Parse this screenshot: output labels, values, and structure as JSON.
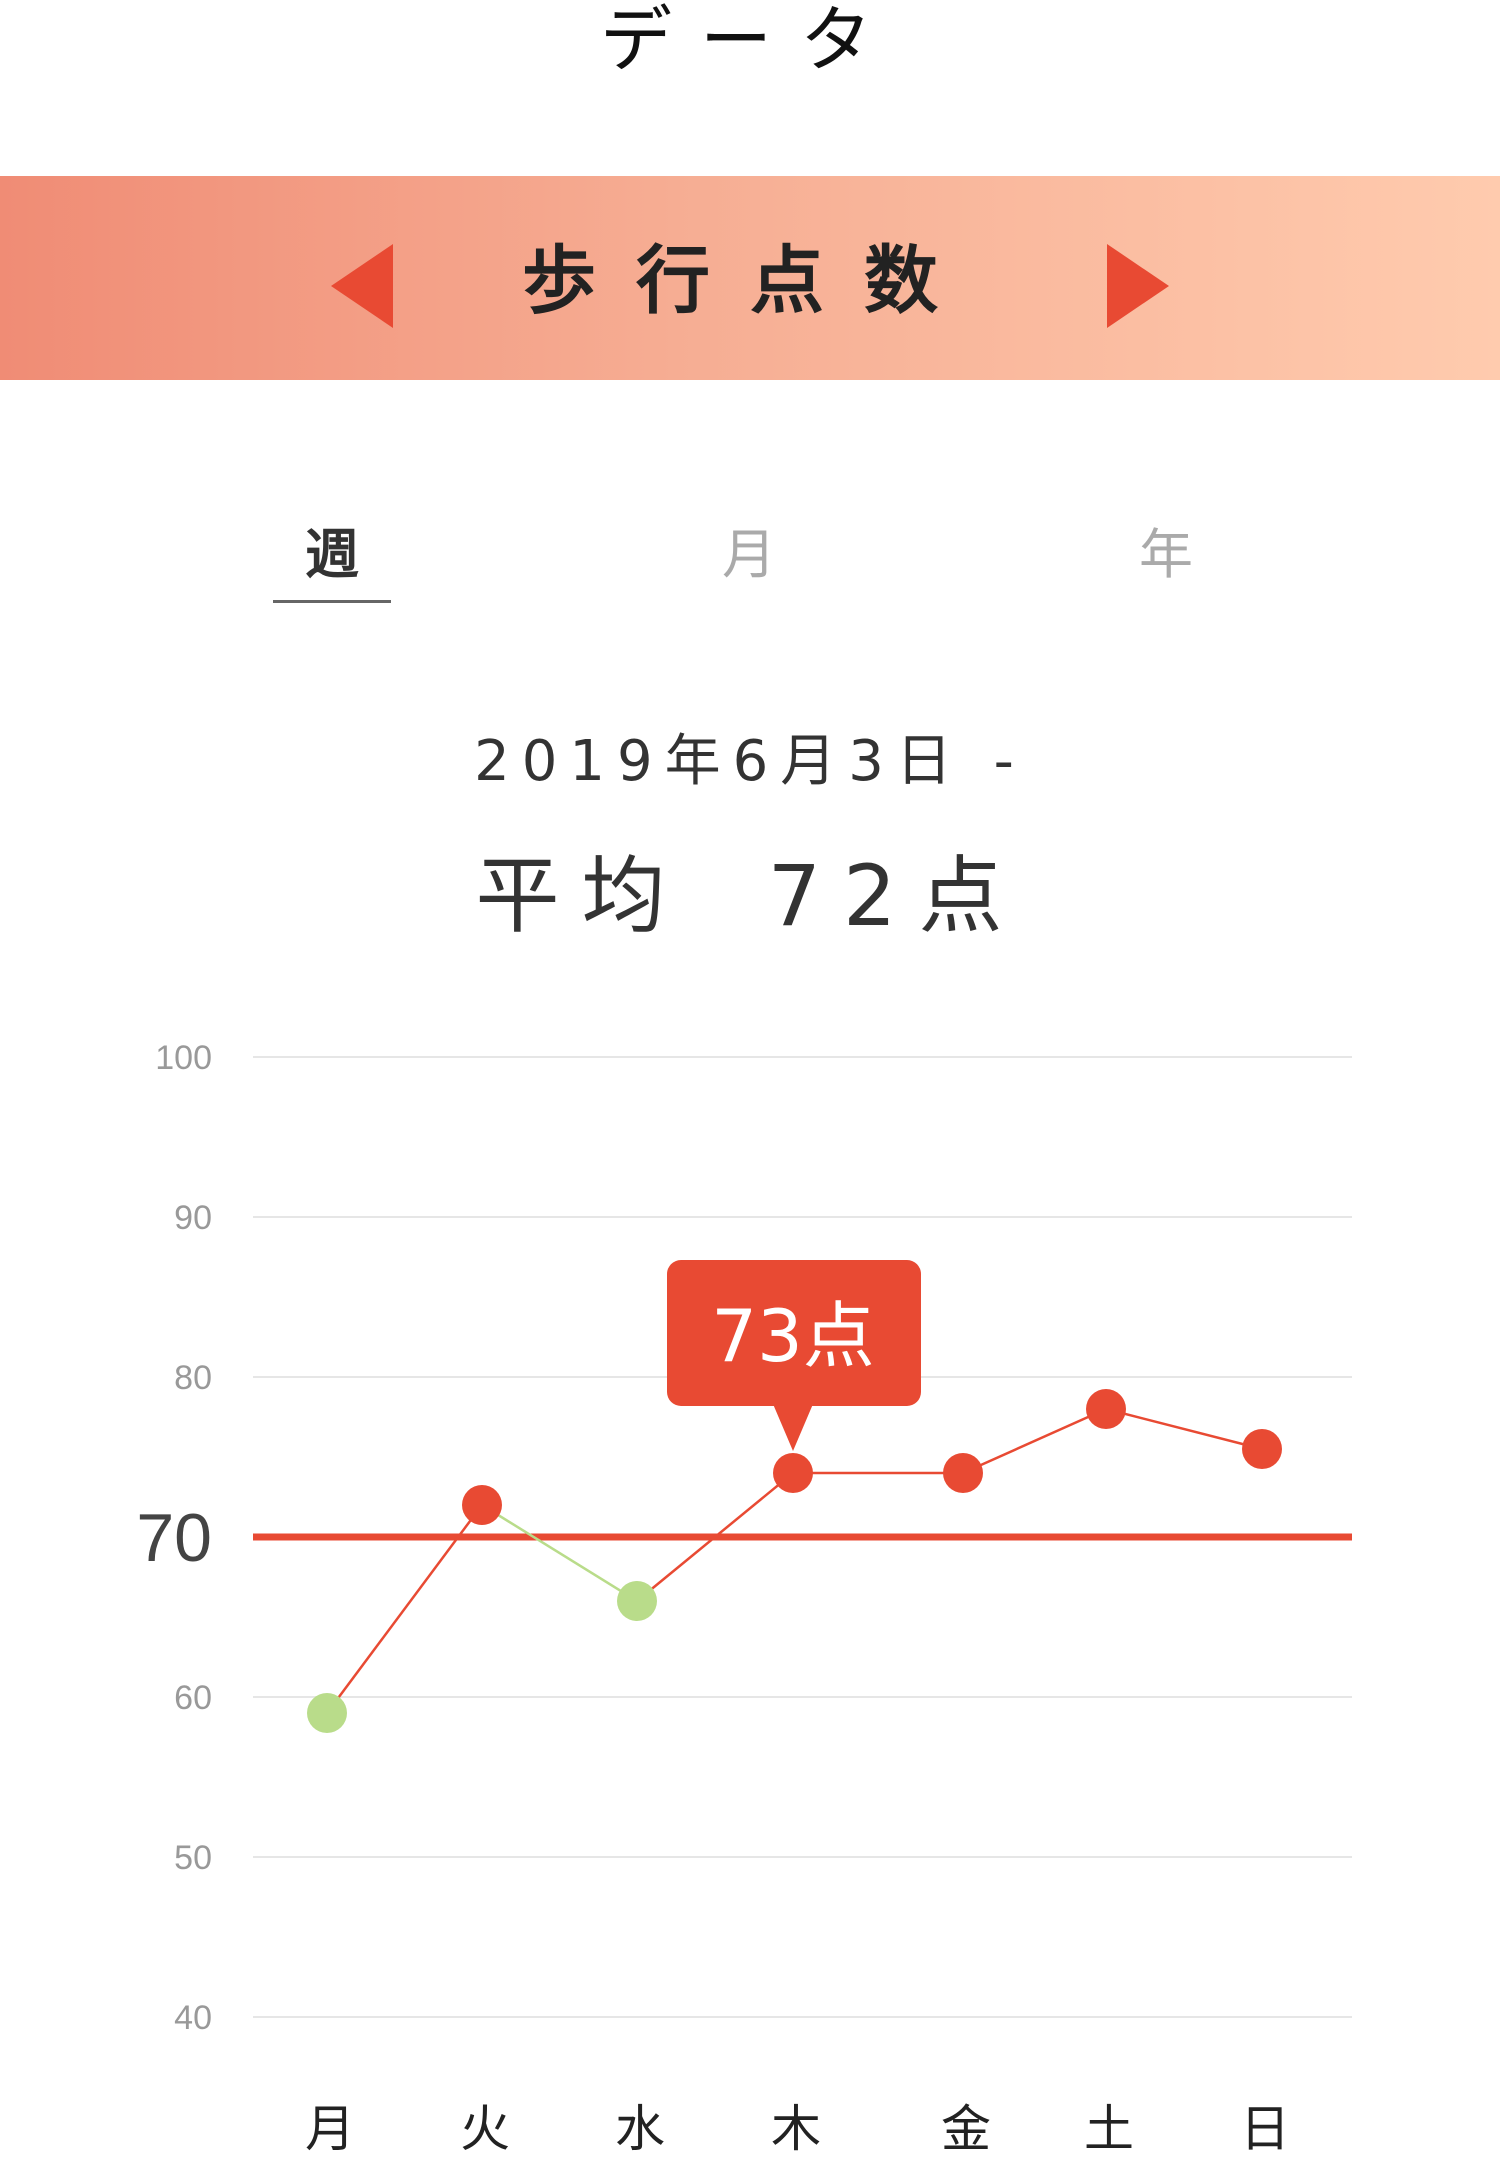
{
  "header": {
    "title": "データ"
  },
  "banner": {
    "title": "歩行点数",
    "colors": {
      "arrow": "#e84a33"
    }
  },
  "tabs": [
    {
      "label": "週",
      "selected": true
    },
    {
      "label": "月",
      "selected": false
    },
    {
      "label": "年",
      "selected": false
    }
  ],
  "summary": {
    "date_range": "2019年6月3日 -",
    "average_label": "平均",
    "average_value": "72点"
  },
  "chart_data": {
    "type": "line",
    "categories": [
      "月",
      "火",
      "水",
      "木",
      "金",
      "土",
      "日"
    ],
    "values": [
      59,
      72,
      66,
      74,
      74,
      78,
      75.5
    ],
    "ylim": [
      40,
      100
    ],
    "yticks": [
      "100",
      "90",
      "80",
      "60",
      "50",
      "40"
    ],
    "threshold": {
      "value": 70,
      "label": "70"
    },
    "tooltip": {
      "category": "木",
      "text": "73点"
    },
    "grid": true,
    "colors": {
      "above": "#e84a33",
      "below": "#b9dc8a",
      "threshold": "#e84a33",
      "grid": "#e6e6e6"
    }
  }
}
